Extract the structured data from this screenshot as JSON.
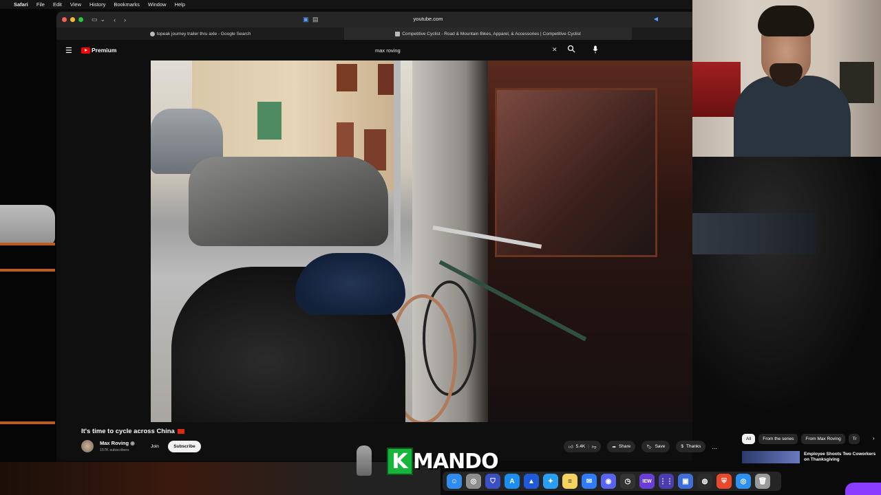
{
  "menubar": {
    "apple_icon": "apple-icon",
    "app": "Safari",
    "items": [
      "File",
      "Edit",
      "View",
      "History",
      "Bookmarks",
      "Window",
      "Help"
    ]
  },
  "toolbar": {
    "address": "youtube.com"
  },
  "tabs": [
    {
      "title": "topeak journey trailer thru axle - Google Search"
    },
    {
      "title": "Competitive Cyclist - Road & Mountain Bikes, Apparel, & Accessories | Competitive Cyclist"
    }
  ],
  "youtube": {
    "logo_text": "Premium",
    "search_value": "max roving",
    "video": {
      "title": "It's time to cycle across China",
      "channel": "Max Roving",
      "subscribers": "157K subscribers",
      "join_label": "Join",
      "subscribe_label": "Subscribe",
      "likes": "5.4K",
      "share_label": "Share",
      "save_label": "Save",
      "thanks_label": "Thanks",
      "more_label": "..."
    },
    "chips": [
      "All",
      "From the series",
      "From Max Roving",
      "Tr"
    ],
    "recommended": {
      "title": "Employee Shoots Two Coworkers on Thanksgiving"
    }
  },
  "overlay": {
    "logo_k": "K",
    "logo_rest": "MANDO"
  },
  "dock": {
    "apps": [
      "finder-icon",
      "launchpad-icon",
      "bitwarden-icon",
      "appstore-icon",
      "safari-alt-icon",
      "safari-icon",
      "notes-icon",
      "mail-icon",
      "discord-icon",
      "activity-icon",
      "news-icon",
      "grid-icon",
      "finder2-icon",
      "obs-icon",
      "brave-icon",
      "chrome-icon",
      "trash-icon"
    ]
  },
  "colors": {
    "youtube_red": "#ff0000",
    "chip_active": "#f1f1f1",
    "logo_green": "#18b53c"
  }
}
